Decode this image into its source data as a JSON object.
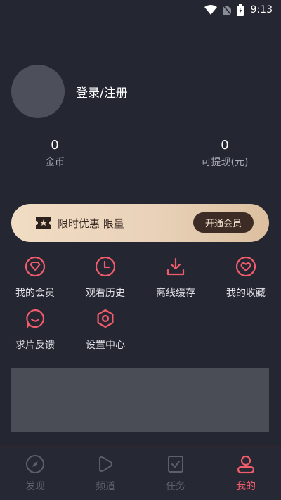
{
  "status_bar": {
    "time": "9:13"
  },
  "profile": {
    "login_label": "登录/注册"
  },
  "stats": [
    {
      "value": "0",
      "label": "金币"
    },
    {
      "value": "0",
      "label": "可提现(元)"
    }
  ],
  "vip": {
    "text": "限时优惠 限量",
    "button_label": "开通会员"
  },
  "menu": [
    {
      "label": "我的会员",
      "icon": "diamond-icon"
    },
    {
      "label": "观看历史",
      "icon": "clock-icon"
    },
    {
      "label": "离线缓存",
      "icon": "download-icon"
    },
    {
      "label": "我的收藏",
      "icon": "heart-icon"
    },
    {
      "label": "求片反馈",
      "icon": "chat-icon"
    },
    {
      "label": "设置中心",
      "icon": "settings-icon"
    }
  ],
  "tabs": [
    {
      "label": "发现",
      "icon": "compass-icon",
      "active": false
    },
    {
      "label": "频道",
      "icon": "play-icon",
      "active": false
    },
    {
      "label": "任务",
      "icon": "task-icon",
      "active": false
    },
    {
      "label": "我的",
      "icon": "user-icon",
      "active": true
    }
  ],
  "colors": {
    "background": "#242631",
    "accent": "#f05c6b",
    "vip_gold": "#e9d2b9",
    "vip_button": "#3d2c26"
  }
}
